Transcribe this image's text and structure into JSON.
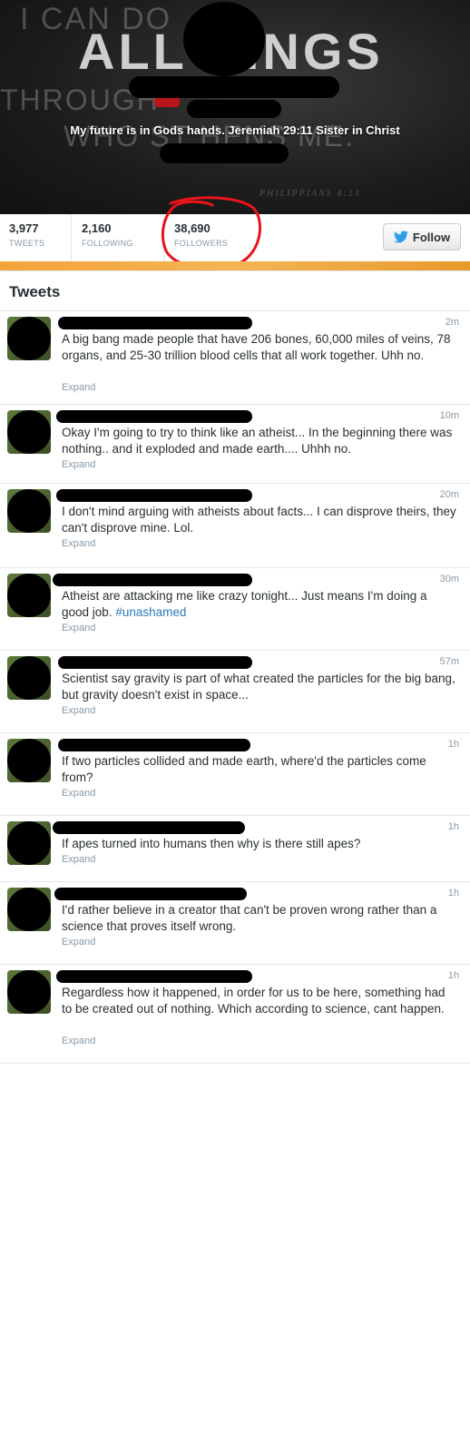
{
  "header": {
    "bg_line1": "I CAN DO",
    "bg_line2": "ALL  HINGS",
    "bg_line3": "THROUGH",
    "bg_line4": "WHO ST       HENS ME.",
    "bg_ref": "PHILIPPIANS 4:13",
    "bio": "My future is in Gods hands. Jeremiah 29:11 Sister in Christ"
  },
  "stats": {
    "tweets_count": "3,977",
    "tweets_label": "TWEETS",
    "following_count": "2,160",
    "following_label": "FOLLOWING",
    "followers_count": "38,690",
    "followers_label": "FOLLOWERS"
  },
  "follow_button": {
    "label": "Follow",
    "icon": "twitter-bird-icon"
  },
  "section_title": "Tweets",
  "expand_label": "Expand",
  "tweets": [
    {
      "time": "2m",
      "text": "A big bang made people that have 206 bones, 60,000 miles of veins, 78 organs, and 25-30 trillion blood cells that all work together. Uhh no."
    },
    {
      "time": "10m",
      "text": "Okay I'm going to try to think like an atheist... In the beginning there was nothing.. and it exploded and made earth.... Uhhh no."
    },
    {
      "time": "20m",
      "text": "I don't mind arguing with atheists about facts... I can disprove theirs, they can't disprove mine. Lol."
    },
    {
      "time": "30m",
      "text": "Atheist are attacking me like crazy tonight... Just means I'm doing a good job.",
      "hashtag": "#unashamed"
    },
    {
      "time": "57m",
      "text": "Scientist say gravity is part of what created the particles for the big bang, but gravity doesn't exist in space..."
    },
    {
      "time": "1h",
      "text": "If two particles collided and made earth, where'd the particles come from?"
    },
    {
      "time": "1h",
      "text": "If apes turned into humans then why is there still apes?"
    },
    {
      "time": "1h",
      "text": "I'd rather believe in a creator that can't be proven wrong rather than a science that proves itself wrong."
    },
    {
      "time": "1h",
      "text": "Regardless how it happened, in order for us to be here, something had to be created out of nothing. Which according to science, cant happen."
    }
  ],
  "colors": {
    "accent": "#2b7bb9",
    "annotation": "#e8141a",
    "strip": "#f3a33a"
  }
}
